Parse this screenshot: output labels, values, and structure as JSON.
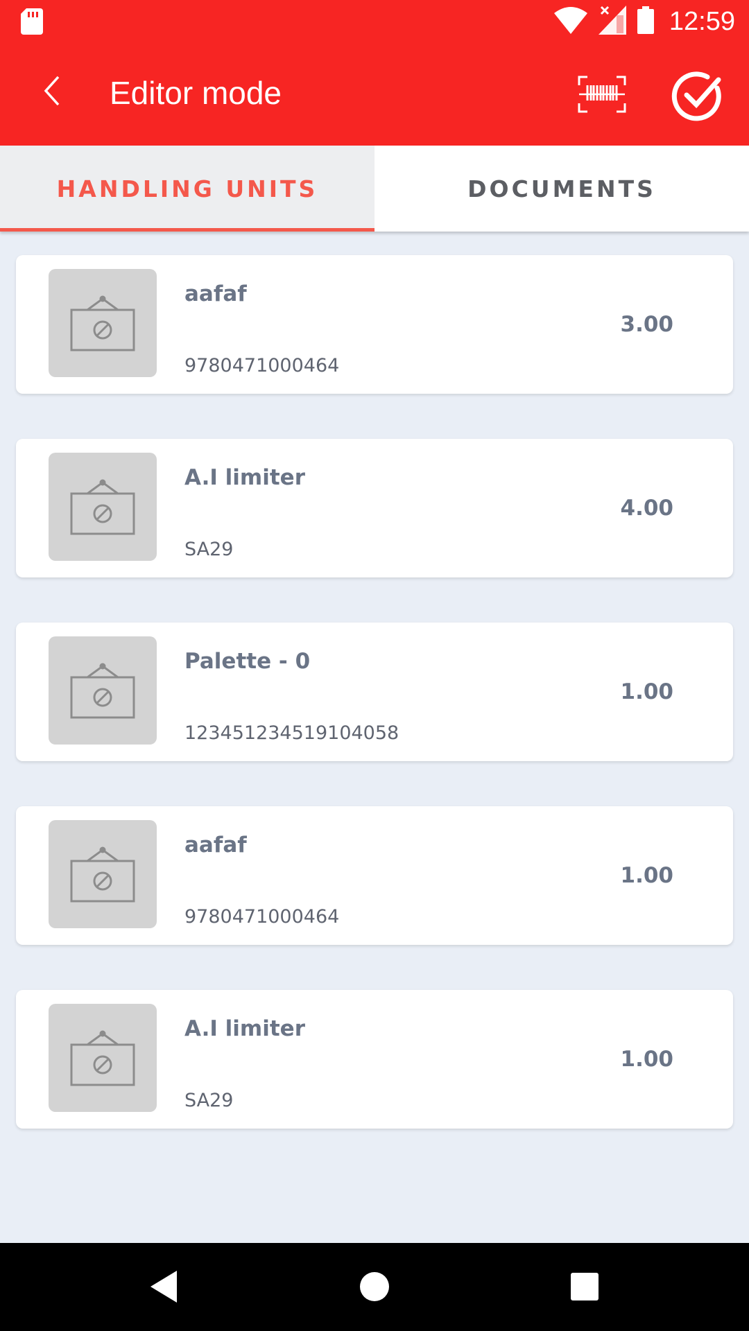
{
  "status_bar": {
    "time": "12:59",
    "icons": [
      "sd-card-icon",
      "wifi-icon",
      "signal-no-sim-icon",
      "battery-icon"
    ]
  },
  "app_bar": {
    "title": "Editor mode",
    "back_icon": "chevron-left-icon",
    "barcode_icon": "barcode-scan-icon",
    "confirm_icon": "check-circle-icon"
  },
  "tabs": [
    {
      "label": "HANDLING UNITS",
      "active": true
    },
    {
      "label": "DOCUMENTS",
      "active": false
    }
  ],
  "items": [
    {
      "title": "aafaf",
      "code": "9780471000464",
      "quantity": "3.00"
    },
    {
      "title": "A.I limiter",
      "code": "SA29",
      "quantity": "4.00"
    },
    {
      "title": "Palette - 0",
      "code": "123451234519104058",
      "quantity": "1.00"
    },
    {
      "title": "aafaf",
      "code": "9780471000464",
      "quantity": "1.00"
    },
    {
      "title": "A.I limiter",
      "code": "SA29",
      "quantity": "1.00"
    }
  ],
  "colors": {
    "app_bar": "#f72523",
    "accent": "#f4584b",
    "background": "#e9eef6"
  },
  "nav_bar": {
    "icons": [
      "back-triangle-icon",
      "home-circle-icon",
      "recents-square-icon"
    ]
  }
}
